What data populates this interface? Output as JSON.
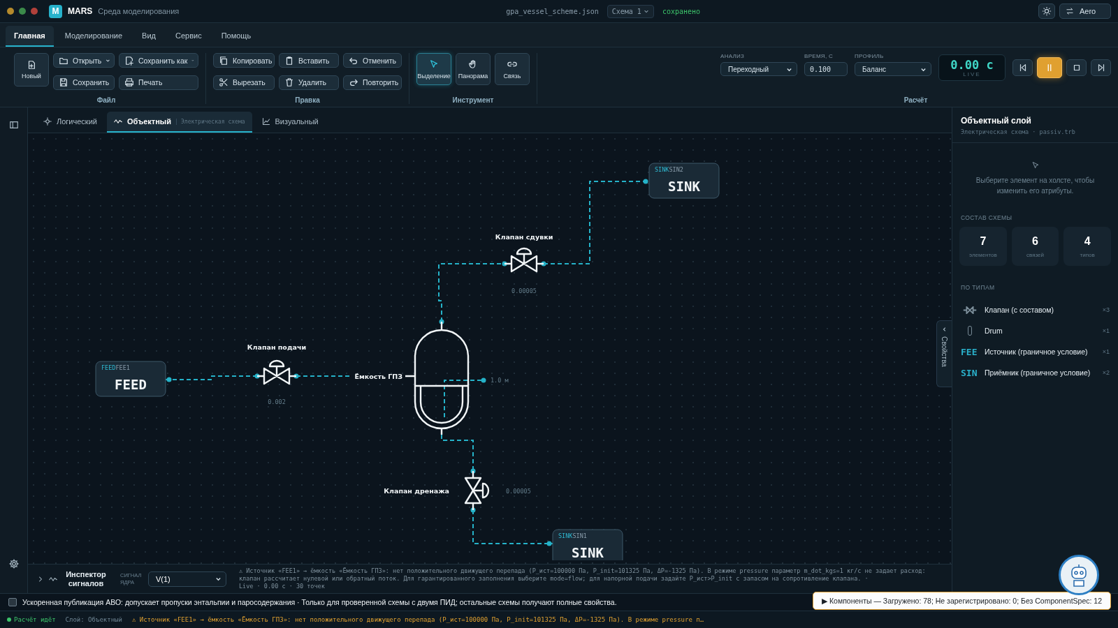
{
  "window": {
    "logo": "M",
    "app_name": "MARS",
    "subtitle": "Среда моделирования",
    "file_name": "gpa_vessel_scheme.json",
    "scheme": "Схема 1",
    "save_status": "сохранено",
    "preset_button": "Aero"
  },
  "menu_tabs": [
    {
      "label": "Главная",
      "selected": true
    },
    {
      "label": "Моделирование",
      "selected": false
    },
    {
      "label": "Вид",
      "selected": false
    },
    {
      "label": "Сервис",
      "selected": false
    },
    {
      "label": "Помощь",
      "selected": false
    }
  ],
  "ribbon": {
    "file": {
      "title": "Файл",
      "new_button": "Новый",
      "buttons": [
        {
          "label": "Открыть",
          "dropdown": true
        },
        {
          "label": "Сохранить как",
          "dropdown": true
        },
        {
          "label": "Сохранить"
        },
        {
          "label": "Печать"
        }
      ]
    },
    "edit": {
      "title": "Правка",
      "buttons": [
        "Копировать",
        "Вставить",
        "Отменить",
        "Вырезать",
        "Удалить",
        "Повторить"
      ]
    },
    "tools": {
      "title": "Инструмент",
      "buttons": [
        {
          "label": "Выделение",
          "selected": true
        },
        {
          "label": "Панорама",
          "selected": false
        },
        {
          "label": "Связь",
          "selected": false
        }
      ]
    },
    "calc": {
      "title": "Расчёт",
      "fields": [
        {
          "label": "АНАЛИЗ",
          "value": "Переходный",
          "kind": "select"
        },
        {
          "label": "ВРЕМЯ, С",
          "value": "0.100",
          "kind": "input"
        },
        {
          "label": "ПРОФИЛЬ",
          "value": "Баланс",
          "kind": "select"
        }
      ],
      "timer": {
        "value": "0.00 с",
        "caption": "LIVE"
      },
      "playback": [
        {
          "active": false
        },
        {
          "active": true
        },
        {
          "active": false
        },
        {
          "active": false
        }
      ]
    }
  },
  "layer_tabs": [
    {
      "label": "Логический",
      "selected": false
    },
    {
      "label": "Объектный",
      "selected": true,
      "sub": "Электрическая схема"
    },
    {
      "label": "Визуальный",
      "selected": false
    }
  ],
  "diagram": {
    "nodes": [
      {
        "tag": "FEED",
        "id": "FEE1",
        "title": "FEED"
      },
      {
        "tag": "SINK",
        "id": "SIN2",
        "title": "SINK"
      },
      {
        "tag": "SINK",
        "id": "SIN1",
        "title": "SINK"
      }
    ],
    "valves": [
      {
        "label": "Клапан подачи",
        "value": "0.002"
      },
      {
        "label": "Клапан сдувки",
        "value": "0.00005"
      },
      {
        "label": "Клапан дренажа",
        "value": "0.00005"
      }
    ],
    "vessel": {
      "label": "Ёмкость ГПЗ",
      "level_reading": "1.0 м"
    }
  },
  "side_tab": {
    "label": "Свойства"
  },
  "inspector": {
    "title": "Инспектор сигналов",
    "signal_label": "СИГНАЛ ЯДРА",
    "signal": "V(1)",
    "log": "⚠ Источник «FEE1» → ёмкость «Ёмкость ГПЗ»: нет положительного движущего перепада (P_ист=100000 Па, P_init=101325 Па, ΔP=-1325 Па). В режиме pressure параметр m_dot_kgs=1 кг/с не задает расход: клапан рассчитает нулевой или обратный поток. Для гарантированного заполнения выберите mode=flow; для напорной подачи задайте P_ист>P_init с запасом на сопротивление клапана. ·",
    "footer": "Live · 0.00 с · 30 точек"
  },
  "properties_panel": {
    "title": "Объектный слой",
    "subtitle": "Электрическая схема · passiv.trb",
    "hint": "Выберите элемент на холсте, чтобы изменить его атрибуты.",
    "composition_heading": "СОСТАВ СХЕМЫ",
    "stats": [
      {
        "value": "7",
        "label": "элементов"
      },
      {
        "value": "6",
        "label": "связей"
      },
      {
        "value": "4",
        "label": "типов"
      }
    ],
    "types_heading": "ПО ТИПАМ",
    "types": [
      {
        "kind": "icon",
        "label": "Клапан (с составом)",
        "count": "×3"
      },
      {
        "kind": "icon",
        "label": "Drum",
        "count": "×1"
      },
      {
        "kind": "badge",
        "badge": "FEE",
        "label": "Источник (граничное условие)",
        "count": "×1"
      },
      {
        "kind": "badge",
        "badge": "SIN",
        "label": "Приёмник (граничное условие)",
        "count": "×2"
      }
    ]
  },
  "notice": {
    "checked": false,
    "text": "Ускоренная публикация АВО: допускает пропуски энтальпии и паросодержания · Только для проверенной схемы с двумя ПИД; остальные схемы получают полные свойства."
  },
  "status_bar": {
    "running": true,
    "state": "Расчёт идёт",
    "layer": "Слой: Объектный",
    "warning": "⚠ Источник «FEE1» → ёмкость «Ёмкость ГПЗ»: нет положительного движущего перепада (P_ист=100000 Па, P_init=101325 Па, ΔP=-1325 Па). В режиме pressure п…"
  },
  "toast": {
    "text": "▶ Компоненты — Загружено: 78; Не зарегистрировано: 0; Без ComponentSpec: 12"
  }
}
